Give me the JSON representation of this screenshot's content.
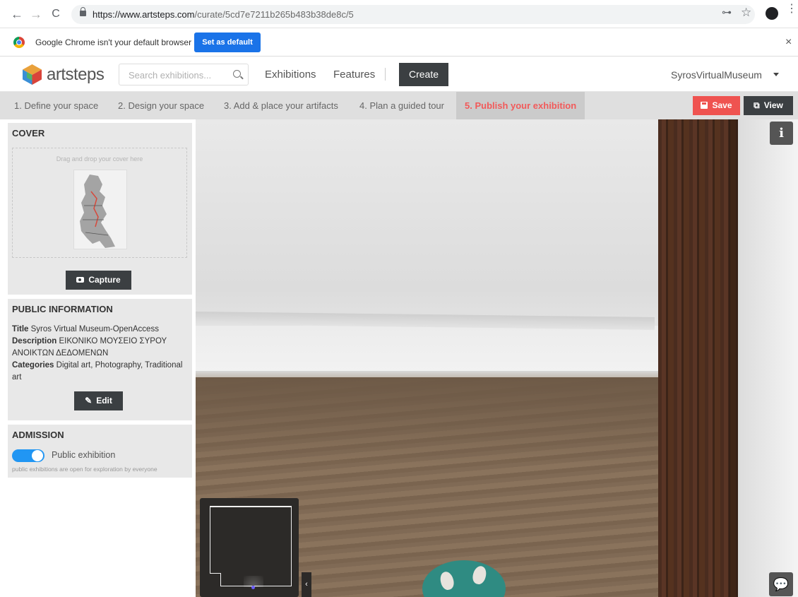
{
  "browser": {
    "url_host": "https://www.artsteps.com",
    "url_path": "/curate/5cd7e7211b265b483b38de8c/5",
    "back_glyph": "←",
    "forward_glyph": "→",
    "reload_glyph": "C",
    "key_glyph": "⊶",
    "star_glyph": "☆",
    "menu_glyph": "⋮"
  },
  "infobar": {
    "message": "Google Chrome isn't your default browser",
    "button": "Set as default",
    "close_glyph": "×"
  },
  "header": {
    "logo_text": "artsteps",
    "search_placeholder": "Search exhibitions...",
    "nav": [
      "Exhibitions",
      "Features"
    ],
    "create_label": "Create",
    "username": "SyrosVirtualMuseum"
  },
  "steps": {
    "items": [
      "1. Define your space",
      "2. Design your space",
      "3. Add & place your artifacts",
      "4. Plan a guided tour",
      "5. Publish your exhibition"
    ],
    "save_label": "Save",
    "view_label": "View"
  },
  "cover": {
    "title": "COVER",
    "drop_hint": "Drag and drop your cover here",
    "capture_label": "Capture"
  },
  "public_info": {
    "title": "PUBLIC INFORMATION",
    "title_label": "Title",
    "title_value": "Syros Virtual Museum-OpenAccess",
    "description_label": "Description",
    "description_value": "ΕΙΚΟΝΙΚΟ ΜΟΥΣΕΙΟ ΣΥΡΟΥ ΑΝΟΙΚΤΩΝ ΔΕΔΟΜΕΝΩΝ",
    "categories_label": "Categories",
    "categories_value": "Digital art, Photography, Traditional art",
    "edit_label": "Edit"
  },
  "admission": {
    "title": "ADMISSION",
    "toggle_label": "Public exhibition",
    "toggle_on": true,
    "help": "public exhibitions are open for exploration by everyone"
  },
  "viewport": {
    "info_glyph": "i",
    "collapse_glyph": "‹",
    "chat_glyph": "💬"
  },
  "colors": {
    "accent_blue": "#1a73e8",
    "save_red": "#ef5350",
    "active_step": "#f25a5a",
    "dark_button": "#3b3f42",
    "toggle_blue": "#2196f3"
  }
}
